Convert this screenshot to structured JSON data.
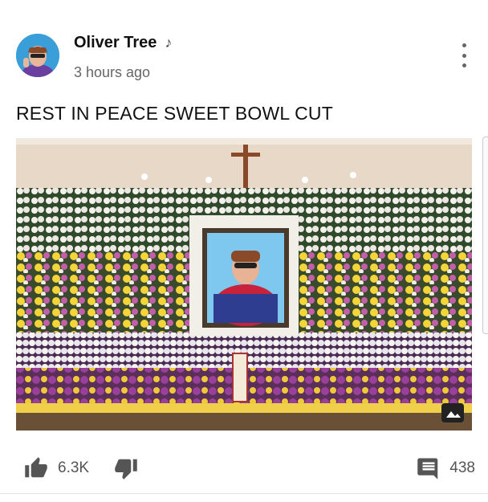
{
  "post": {
    "author": "Oliver Tree",
    "time": "3 hours ago",
    "text": "REST IN PEACE SWEET BOWL CUT"
  },
  "actions": {
    "likes": "6.3K",
    "comments": "438"
  },
  "icons": {
    "author_badge": "music-note-icon",
    "menu": "more-vert-icon",
    "like": "thumb-up-icon",
    "dislike": "thumb-down-icon",
    "comment": "comment-icon",
    "image": "image-icon"
  },
  "colors": {
    "text": "#111111",
    "secondary": "#666666",
    "icon": "#555555"
  }
}
